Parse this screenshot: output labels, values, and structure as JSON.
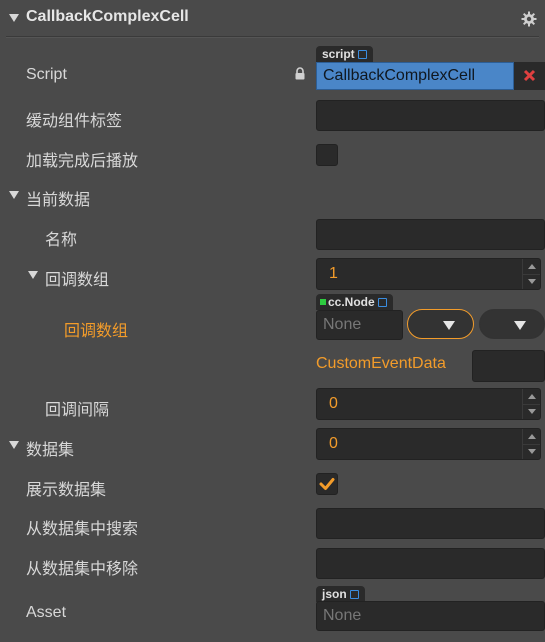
{
  "header": {
    "title": "CallbackComplexCell",
    "gear_icon": "gear-icon"
  },
  "rows": {
    "script": {
      "label": "Script",
      "tag": "script",
      "value": "CallbackComplexCell"
    },
    "cache_tag": {
      "label": "缓动组件标签",
      "value": ""
    },
    "load_play": {
      "label": "加载完成后播放",
      "checked": false
    },
    "current_data": {
      "label": "当前数据"
    },
    "name": {
      "label": "名称",
      "value": ""
    },
    "callback_array": {
      "label": "回调数组",
      "value": "1"
    },
    "callback_item": {
      "label": "回调数组",
      "tag": "cc.Node",
      "value": "None",
      "custom_event_label": "CustomEventData",
      "custom_event_value": ""
    },
    "interval": {
      "label": "回调间隔",
      "value": "0"
    },
    "dataset": {
      "label": "数据集",
      "value": "0"
    },
    "show_dataset": {
      "label": "展示数据集",
      "checked": true
    },
    "search_dataset": {
      "label": "从数据集中搜索",
      "value": ""
    },
    "remove_dataset": {
      "label": "从数据集中移除",
      "value": ""
    },
    "asset": {
      "label": "Asset",
      "tag": "json",
      "value": "None"
    }
  },
  "colors": {
    "accent": "#f39c2a",
    "link": "#3a8de0",
    "script_field": "#4a86c8",
    "remove": "#e04040"
  }
}
